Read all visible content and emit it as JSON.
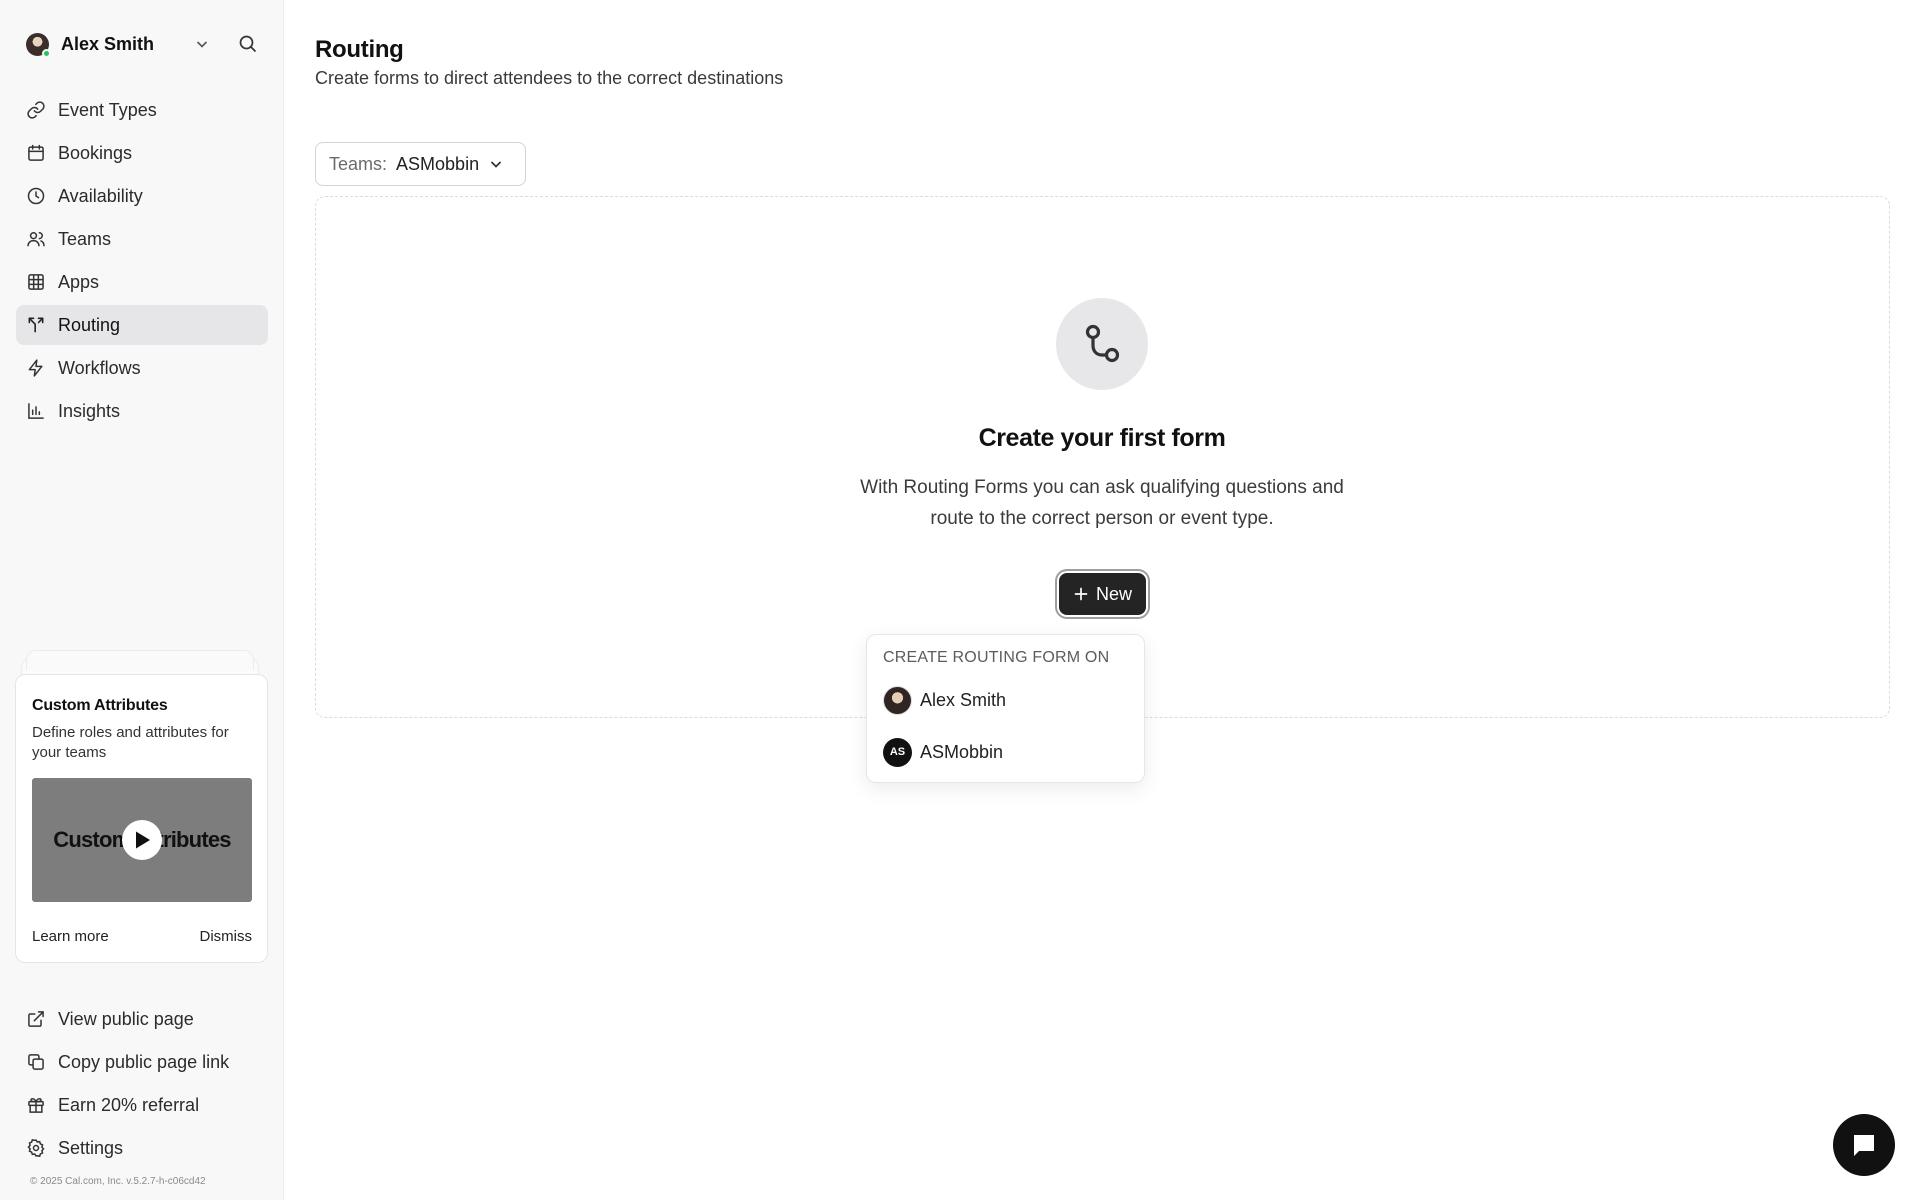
{
  "user": {
    "name": "Alex Smith"
  },
  "nav": [
    {
      "label": "Event Types",
      "icon": "link-icon"
    },
    {
      "label": "Bookings",
      "icon": "calendar-icon"
    },
    {
      "label": "Availability",
      "icon": "clock-icon"
    },
    {
      "label": "Teams",
      "icon": "users-icon"
    },
    {
      "label": "Apps",
      "icon": "grid-icon"
    },
    {
      "label": "Routing",
      "icon": "routing-icon",
      "active": true
    },
    {
      "label": "Workflows",
      "icon": "zap-icon"
    },
    {
      "label": "Insights",
      "icon": "bar-chart-icon"
    }
  ],
  "promo": {
    "title": "Custom Attributes",
    "description": "Define roles and attributes for your teams",
    "video_text": "Custom Attributes",
    "learn_more": "Learn more",
    "dismiss": "Dismiss"
  },
  "bottom_nav": [
    {
      "label": "View public page",
      "icon": "external-link-icon"
    },
    {
      "label": "Copy public page link",
      "icon": "copy-icon"
    },
    {
      "label": "Earn 20% referral",
      "icon": "gift-icon"
    },
    {
      "label": "Settings",
      "icon": "gear-icon"
    }
  ],
  "copyright": "© 2025 Cal.com, Inc. v.5.2.7-h-c06cd42",
  "page": {
    "title": "Routing",
    "subtitle": "Create forms to direct attendees to the correct destinations"
  },
  "filter": {
    "label": "Teams:",
    "value": "ASMobbin"
  },
  "empty_state": {
    "title": "Create your first form",
    "description": "With Routing Forms you can ask qualifying questions and route to the correct person or event type.",
    "button_label": "New"
  },
  "dropdown": {
    "header": "CREATE ROUTING FORM ON",
    "items": [
      {
        "label": "Alex Smith",
        "avatar": "photo"
      },
      {
        "label": "ASMobbin",
        "avatar": "initials",
        "initials": "AS"
      }
    ]
  },
  "colors": {
    "primary_button": "#242424",
    "active_nav": "#e6e6e8",
    "online": "#22c55e"
  }
}
